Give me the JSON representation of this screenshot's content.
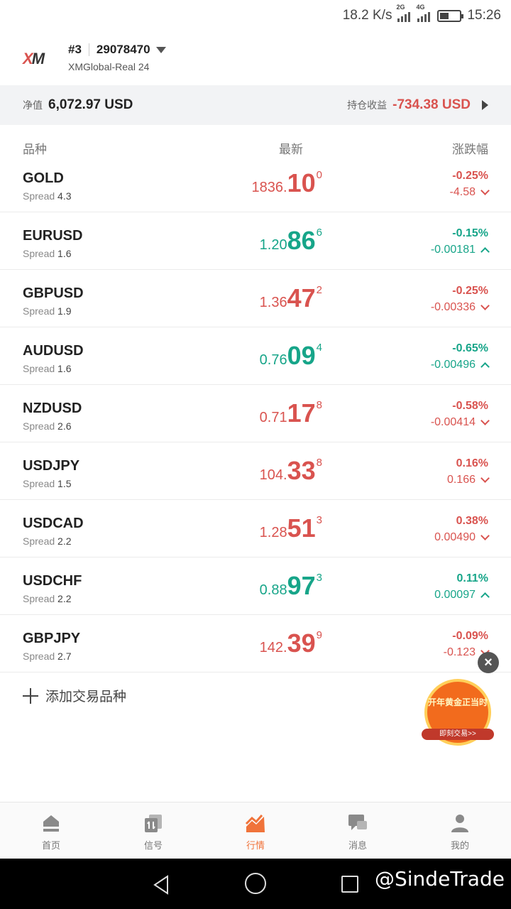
{
  "status_bar": {
    "speed": "18.2 K/s",
    "sim1": "2G",
    "sim2": "4G",
    "battery_level": 0.45,
    "time": "15:26"
  },
  "account": {
    "logo": "XM",
    "number": "#3",
    "id": "29078470",
    "server": "XMGlobal-Real 24"
  },
  "equity": {
    "label": "净值",
    "value": "6,072.97 USD",
    "pl_label": "持仓收益",
    "pl_value": "-734.38 USD"
  },
  "columns": {
    "symbol": "品种",
    "price": "最新",
    "change": "涨跌幅"
  },
  "rows": [
    {
      "symbol": "GOLD",
      "spread_label": "Spread",
      "spread": "4.3",
      "price_small": "1836.",
      "price_big": "10",
      "price_sup": "0",
      "pct": "-0.25%",
      "delta": "-4.58",
      "direction": "down",
      "color": "red"
    },
    {
      "symbol": "EURUSD",
      "spread_label": "Spread",
      "spread": "1.6",
      "price_small": "1.20",
      "price_big": "86",
      "price_sup": "6",
      "pct": "-0.15%",
      "delta": "-0.00181",
      "direction": "up",
      "color": "green"
    },
    {
      "symbol": "GBPUSD",
      "spread_label": "Spread",
      "spread": "1.9",
      "price_small": "1.36",
      "price_big": "47",
      "price_sup": "2",
      "pct": "-0.25%",
      "delta": "-0.00336",
      "direction": "down",
      "color": "red"
    },
    {
      "symbol": "AUDUSD",
      "spread_label": "Spread",
      "spread": "1.6",
      "price_small": "0.76",
      "price_big": "09",
      "price_sup": "4",
      "pct": "-0.65%",
      "delta": "-0.00496",
      "direction": "up",
      "color": "green"
    },
    {
      "symbol": "NZDUSD",
      "spread_label": "Spread",
      "spread": "2.6",
      "price_small": "0.71",
      "price_big": "17",
      "price_sup": "8",
      "pct": "-0.58%",
      "delta": "-0.00414",
      "direction": "down",
      "color": "red"
    },
    {
      "symbol": "USDJPY",
      "spread_label": "Spread",
      "spread": "1.5",
      "price_small": "104.",
      "price_big": "33",
      "price_sup": "8",
      "pct": "0.16%",
      "delta": "0.166",
      "direction": "down",
      "color": "red"
    },
    {
      "symbol": "USDCAD",
      "spread_label": "Spread",
      "spread": "2.2",
      "price_small": "1.28",
      "price_big": "51",
      "price_sup": "3",
      "pct": "0.38%",
      "delta": "0.00490",
      "direction": "down",
      "color": "red"
    },
    {
      "symbol": "USDCHF",
      "spread_label": "Spread",
      "spread": "2.2",
      "price_small": "0.88",
      "price_big": "97",
      "price_sup": "3",
      "pct": "0.11%",
      "delta": "0.00097",
      "direction": "up",
      "color": "green"
    },
    {
      "symbol": "GBPJPY",
      "spread_label": "Spread",
      "spread": "2.7",
      "price_small": "142.",
      "price_big": "39",
      "price_sup": "9",
      "pct": "-0.09%",
      "delta": "-0.123",
      "direction": "down",
      "color": "red"
    }
  ],
  "add_symbol": "添加交易品种",
  "promo": {
    "title": "开年黄金正当时",
    "cta": "即刻交易>>"
  },
  "nav": [
    {
      "label": "首页",
      "icon": "home-icon",
      "active": false
    },
    {
      "label": "信号",
      "icon": "signal-icon",
      "active": false
    },
    {
      "label": "行情",
      "icon": "quotes-chart-icon",
      "active": true
    },
    {
      "label": "消息",
      "icon": "messages-icon",
      "active": false
    },
    {
      "label": "我的",
      "icon": "profile-icon",
      "active": false
    }
  ],
  "watermark": "@SindeTrade",
  "colors": {
    "red": "#d9534f",
    "green": "#17a589",
    "accent": "#f0733a"
  }
}
